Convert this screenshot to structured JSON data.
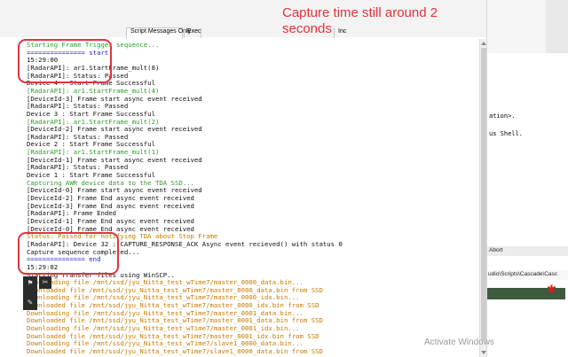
{
  "annotation": {
    "text": "Capture time still around 2 seconds"
  },
  "toolbar": {
    "script_messages_label": "Script Messages Only",
    "exec_label": "Exec",
    "inc_label": "Inc"
  },
  "console": {
    "lines": [
      {
        "text": "Starting Frame Trigger sequence...",
        "color": "#2e9b2e"
      },
      {
        "text": "=============== start",
        "color": "#2323c8"
      },
      {
        "text": "15:29:00",
        "color": "#111111"
      },
      {
        "text": "[RadarAPI]: ar1.StartFrame_mult(8)",
        "color": "#111111"
      },
      {
        "text": "[RadarAPI]: Status: Passed",
        "color": "#111111"
      },
      {
        "text": "Device 4 : Start Frame Successful",
        "color": "#111111"
      },
      {
        "text": "[RadarAPI]: ar1.StartFrame_mult(4)",
        "color": "#2e9b2e"
      },
      {
        "text": "[DeviceId-3] Frame start async event received",
        "color": "#111111"
      },
      {
        "text": "[RadarAPI]: Status: Passed",
        "color": "#111111"
      },
      {
        "text": "Device 3 : Start Frame Successful",
        "color": "#111111"
      },
      {
        "text": "[RadarAPI]: ar1.StartFrame_mult(2)",
        "color": "#2e9b2e"
      },
      {
        "text": "[DeviceId-2] Frame start async event received",
        "color": "#111111"
      },
      {
        "text": "[RadarAPI]: Status: Passed",
        "color": "#111111"
      },
      {
        "text": "Device 2 : Start Frame Successful",
        "color": "#111111"
      },
      {
        "text": "[RadarAPI]: ar1.StartFrame_mult(1)",
        "color": "#2e9b2e"
      },
      {
        "text": "[DeviceId-1] Frame start async event received",
        "color": "#111111"
      },
      {
        "text": "[RadarAPI]: Status: Passed",
        "color": "#111111"
      },
      {
        "text": "Device 1 : Start Frame Successful",
        "color": "#111111"
      },
      {
        "text": "Capturing AWR device data to the TDA SSD...",
        "color": "#2e9b2e"
      },
      {
        "text": "[DeviceId-0] Frame start async event received",
        "color": "#111111"
      },
      {
        "text": "[DeviceId-2] Frame End async event received",
        "color": "#111111"
      },
      {
        "text": "[DeviceId-3] Frame End async event received",
        "color": "#111111"
      },
      {
        "text": "[RadarAPI]: Frame Ended",
        "color": "#111111"
      },
      {
        "text": "[DeviceId-1] Frame End async event received",
        "color": "#111111"
      },
      {
        "text": "[DeviceId-0] Frame End async event received",
        "color": "#111111"
      },
      {
        "text": "Status: Passed for notifying TDA about Stop Frame",
        "color": "#c77a00"
      },
      {
        "text": "[RadarAPI]: Device 32 : CAPTURE_RESPONSE_ACK Async event recieved() with status 0",
        "color": "#111111"
      },
      {
        "text": "Capture sequence completed...",
        "color": "#111111"
      },
      {
        "text": "=============== end",
        "color": "#2323c8"
      },
      {
        "text": "15:29:02",
        "color": "#111111"
      },
      {
        "text": "Starting Transfer files using WinSCP..",
        "color": "#111111"
      },
      {
        "text": "Downloading file /mnt/ssd/jyu_Nitta_test_wTime7/master_0000_data.bin...",
        "color": "#c77a00"
      },
      {
        "text": "Downloaded file /mnt/ssd/jyu_Nitta_test_wTime7/master_0000_data.bin from SSD",
        "color": "#c77a00"
      },
      {
        "text": "Downloading file /mnt/ssd/jyu_Nitta_test_wTime7/master_0000_idx.bin...",
        "color": "#c77a00"
      },
      {
        "text": "Downloaded file /mnt/ssd/jyu_Nitta_test_wTime7/master_0000_idx.bin from SSD",
        "color": "#c77a00"
      },
      {
        "text": "Downloading file /mnt/ssd/jyu_Nitta_test_wTime7/master_0001_data.bin...",
        "color": "#c77a00"
      },
      {
        "text": "Downloaded file /mnt/ssd/jyu_Nitta_test_wTime7/master_0001_data.bin from SSD",
        "color": "#c77a00"
      },
      {
        "text": "Downloading file /mnt/ssd/jyu_Nitta_test_wTime7/master_0001_idx.bin...",
        "color": "#c77a00"
      },
      {
        "text": "Downloaded file /mnt/ssd/jyu_Nitta_test_wTime7/master_0001_idx.bin from SSD",
        "color": "#c77a00"
      },
      {
        "text": "Downloading file /mnt/ssd/jyu_Nitta_test_wTime7/slave1_0000_data.bin...",
        "color": "#c77a00"
      },
      {
        "text": "Downloaded file /mnt/ssd/jyu_Nitta_test_wTime7/slave1_0000_data.bin from SSD",
        "color": "#c77a00"
      }
    ]
  },
  "right_panel": {
    "text_1": "ation>.",
    "text_2": "us Shell.",
    "abort_label": "Abort",
    "path_text": "udio\\Scripts\\Cascade\\Casc"
  },
  "watermark": {
    "text": "Activate Windows"
  }
}
